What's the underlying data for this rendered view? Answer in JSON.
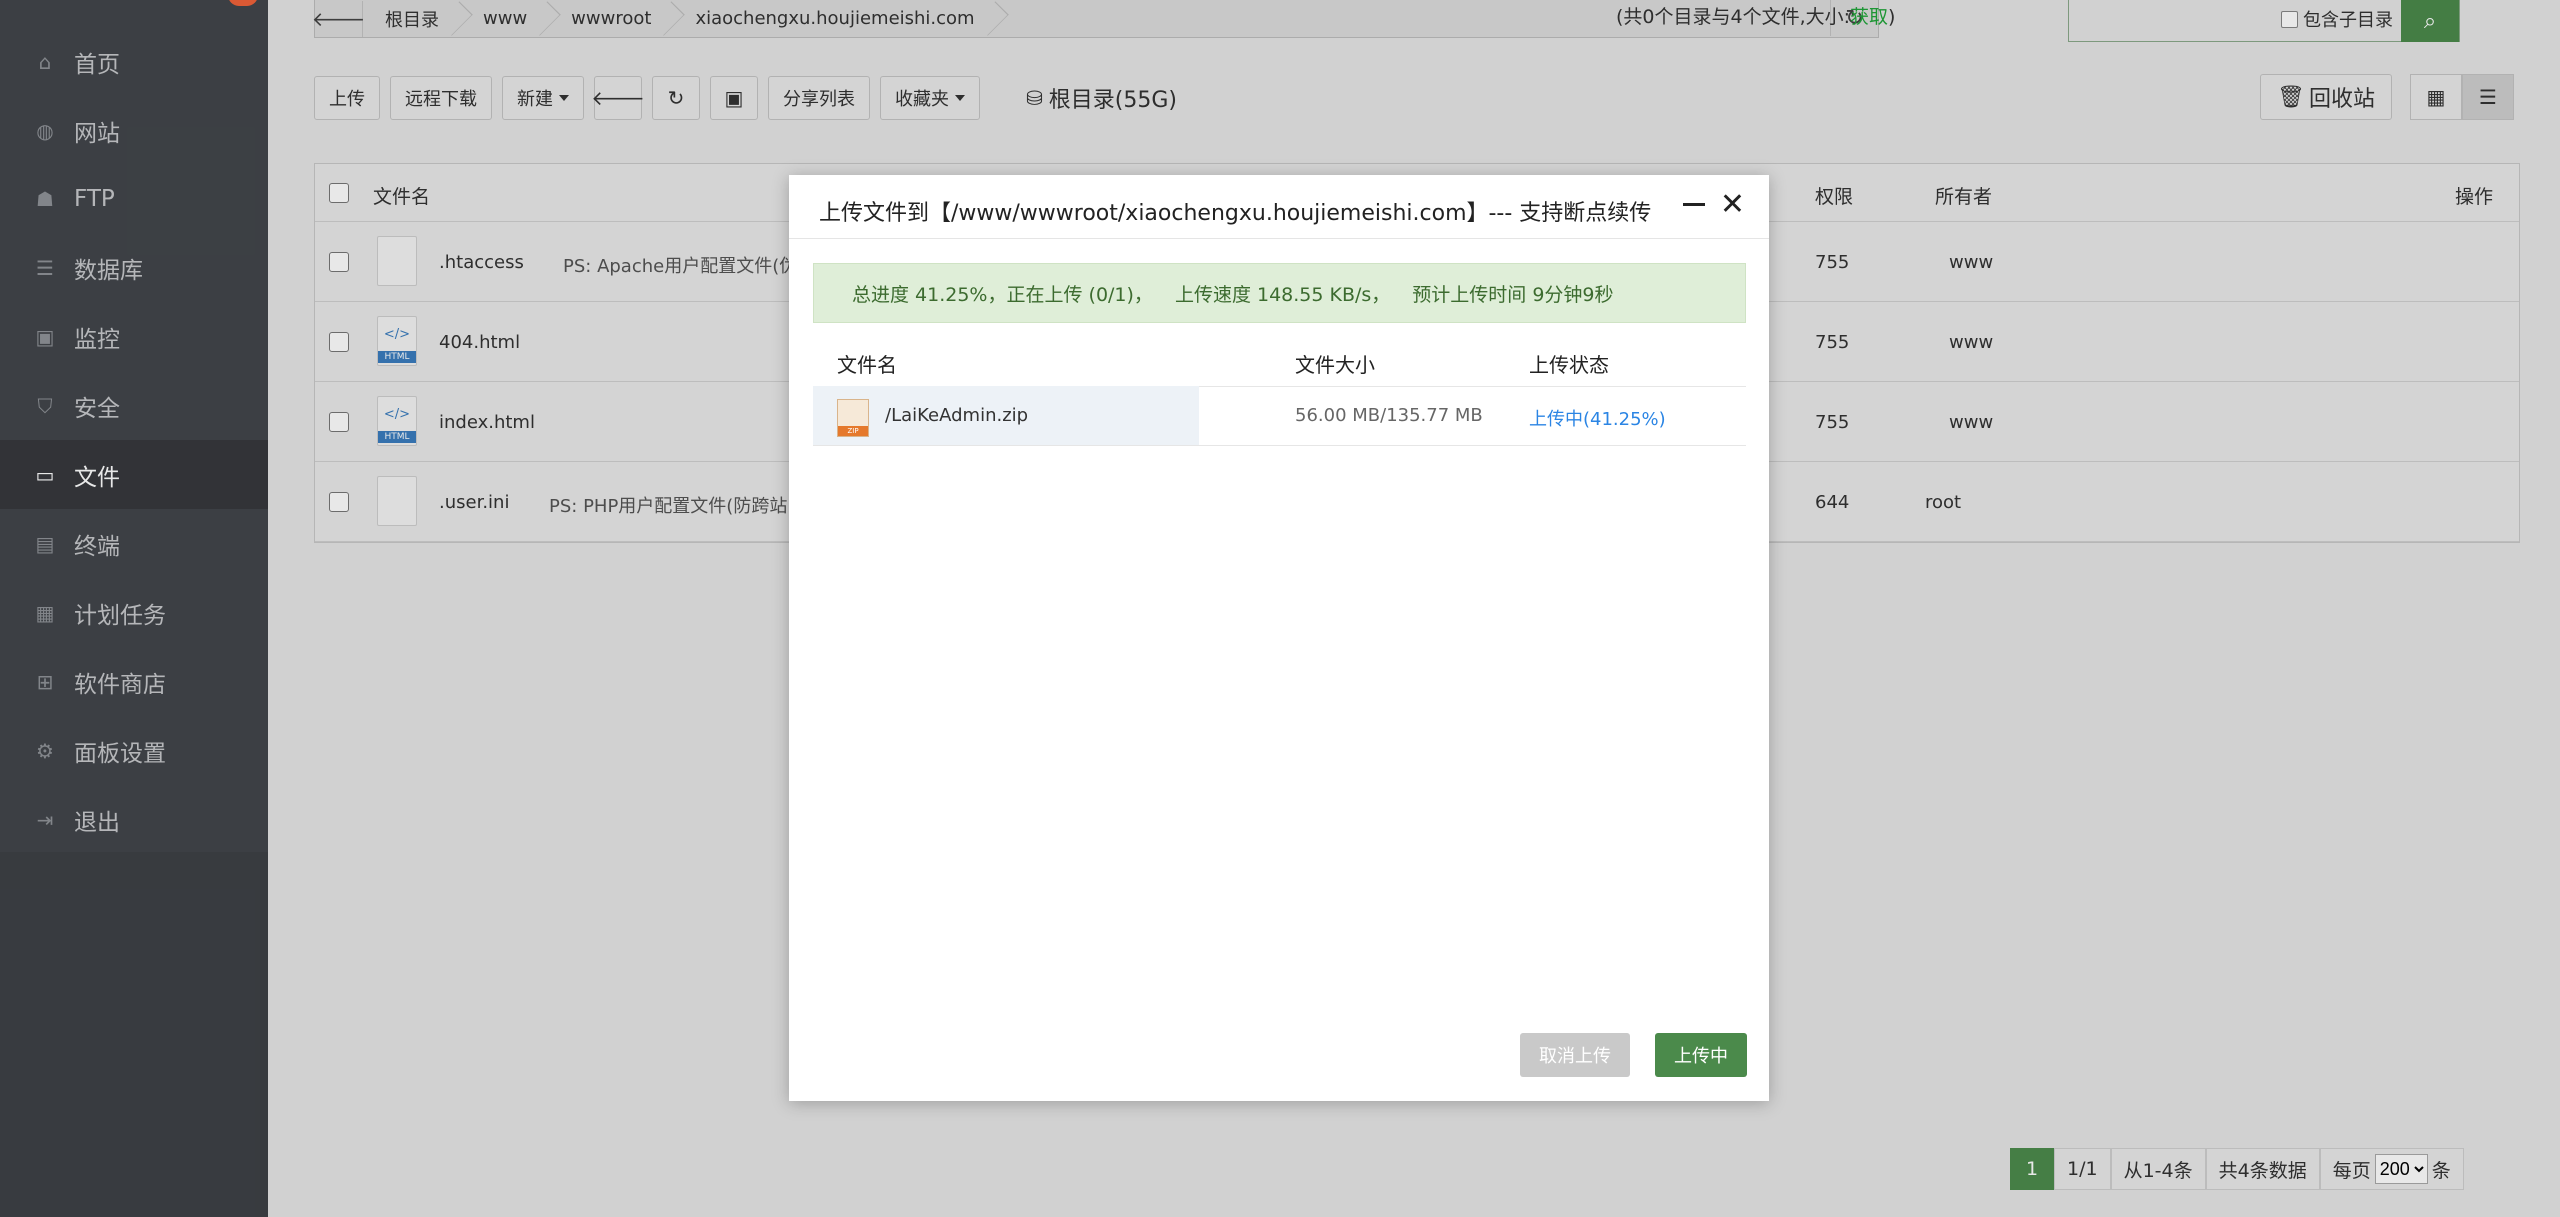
{
  "sidebar": {
    "items": [
      {
        "label": "首页",
        "icon": "home-icon"
      },
      {
        "label": "网站",
        "icon": "globe-icon"
      },
      {
        "label": "FTP",
        "icon": "ftp-user-icon"
      },
      {
        "label": "数据库",
        "icon": "database-icon"
      },
      {
        "label": "监控",
        "icon": "monitor-icon"
      },
      {
        "label": "安全",
        "icon": "shield-icon"
      },
      {
        "label": "文件",
        "icon": "folder-icon"
      },
      {
        "label": "终端",
        "icon": "terminal-icon"
      },
      {
        "label": "计划任务",
        "icon": "calendar-icon"
      },
      {
        "label": "软件商店",
        "icon": "grid-icon"
      },
      {
        "label": "面板设置",
        "icon": "gear-icon"
      },
      {
        "label": "退出",
        "icon": "logout-icon"
      }
    ],
    "active_index": 6
  },
  "breadcrumb": {
    "items": [
      "根目录",
      "www",
      "wwwroot",
      "xiaochengxu.houjiemeishi.com"
    ]
  },
  "dir_info": {
    "prefix": "(共0个目录与4个文件,大小:",
    "link": "获取",
    "suffix": ")"
  },
  "search": {
    "subdir_label": "包含子目录"
  },
  "toolbar": {
    "upload": "上传",
    "remote_download": "远程下载",
    "new": "新建",
    "share_list": "分享列表",
    "favorites": "收藏夹",
    "disk": "根目录(55G)",
    "recycle": "回收站"
  },
  "table": {
    "headers": {
      "name": "文件名",
      "perm": "权限",
      "owner": "所有者",
      "action": "操作"
    },
    "rows": [
      {
        "name": ".htaccess",
        "ps": "PS: Apache用户配置文件(伪",
        "perm": "755",
        "owner": "www",
        "type": "file"
      },
      {
        "name": "404.html",
        "ps": "",
        "perm": "755",
        "owner": "www",
        "type": "html"
      },
      {
        "name": "index.html",
        "ps": "",
        "perm": "755",
        "owner": "www",
        "type": "html"
      },
      {
        "name": ".user.ini",
        "ps": "PS: PHP用户配置文件(防跨站",
        "perm": "644",
        "owner": "root",
        "type": "file"
      }
    ]
  },
  "pager": {
    "current": "1",
    "pages": "1/1",
    "range": "从1-4条",
    "total": "共4条数据",
    "per_page_prefix": "每页",
    "per_page": "200",
    "per_page_suffix": "条"
  },
  "modal": {
    "title": "上传文件到【/www/wwwroot/xiaochengxu.houjiemeishi.com】--- 支持断点续传",
    "progress": {
      "overall": "总进度 41.25%，正在上传 (0/1)，",
      "speed": "上传速度 148.55 KB/s，",
      "eta": "预计上传时间 9分钟9秒"
    },
    "headers": {
      "name": "文件名",
      "size": "文件大小",
      "status": "上传状态"
    },
    "files": [
      {
        "name": "/LaiKeAdmin.zip",
        "size": "56.00 MB/135.77 MB",
        "status": "上传中(41.25%)"
      }
    ],
    "cancel": "取消上传",
    "uploading": "上传中"
  },
  "colors": {
    "accent": "#4b8a4b",
    "status_link": "#2b85e4",
    "progress_bg": "#dfeed8"
  }
}
